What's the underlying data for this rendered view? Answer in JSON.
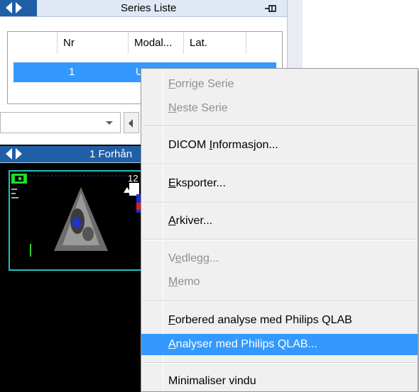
{
  "series_panel": {
    "title": "Series Liste",
    "pin_icon": "pin-icon",
    "columns": [
      "Nr",
      "Modal...",
      "Lat."
    ],
    "row": {
      "nr": "1",
      "modal": "U"
    }
  },
  "viewer_panel": {
    "title": "1 Forhån",
    "overlay_number": "12"
  },
  "context_menu": {
    "items": [
      {
        "pre": "",
        "key": "F",
        "post": "orrige Serie",
        "enabled": false,
        "highlighted": false
      },
      {
        "pre": "",
        "key": "N",
        "post": "este Serie",
        "enabled": false,
        "highlighted": false
      },
      {
        "pre": "DICOM ",
        "key": "I",
        "post": "nformasjon...",
        "enabled": true,
        "highlighted": false
      },
      {
        "pre": "",
        "key": "E",
        "post": "ksporter...",
        "enabled": true,
        "highlighted": false
      },
      {
        "pre": "",
        "key": "A",
        "post": "rkiver...",
        "enabled": true,
        "highlighted": false
      },
      {
        "pre": "V",
        "key": "e",
        "post": "dlegg...",
        "enabled": false,
        "highlighted": false
      },
      {
        "pre": "",
        "key": "M",
        "post": "emo",
        "enabled": false,
        "highlighted": false
      },
      {
        "pre": "",
        "key": "F",
        "post": "orbered analyse med Philips QLAB",
        "enabled": true,
        "highlighted": false
      },
      {
        "pre": "",
        "key": "A",
        "post": "nalyser med Philips QLAB...",
        "enabled": true,
        "highlighted": true
      },
      {
        "pre": "Minimaliser vindu",
        "key": "",
        "post": "",
        "enabled": true,
        "highlighted": false
      }
    ]
  },
  "colors": {
    "titlebar_blue": "#1f5fa8",
    "selection_blue": "#3399ff",
    "menu_bg": "#f0f0f0",
    "disabled_text": "#8f8f8f"
  }
}
